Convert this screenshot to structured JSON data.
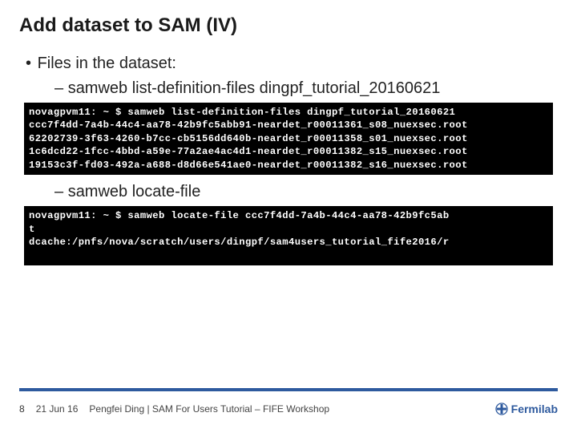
{
  "title": "Add dataset to SAM (IV)",
  "bullets": {
    "l1": "Files in the dataset:",
    "cmd1": "samweb list-definition-files dingpf_tutorial_20160621",
    "cmd2": "samweb locate-file"
  },
  "term1": {
    "prompt": "novagpvm11: ~ $ ",
    "cmd": "samweb list-definition-files dingpf_tutorial_20160621",
    "line1": "ccc7f4dd-7a4b-44c4-aa78-42b9fc5abb91-neardet_r00011361_s08_nuexsec.root",
    "line2": "62202739-3f63-4260-b7cc-cb5156dd640b-neardet_r00011358_s01_nuexsec.root",
    "line3": "1c6dcd22-1fcc-4bbd-a59e-77a2ae4ac4d1-neardet_r00011382_s15_nuexsec.root",
    "line4": "19153c3f-fd03-492a-a688-d8d66e541ae0-neardet_r00011382_s16_nuexsec.root"
  },
  "term2": {
    "prompt": "novagpvm11: ~ $ ",
    "cmd": "samweb locate-file ccc7f4dd-7a4b-44c4-aa78-42b9fc5ab",
    "cont": "t",
    "out": "dcache:/pnfs/nova/scratch/users/dingpf/sam4users_tutorial_fife2016/r"
  },
  "footer": {
    "page": "8",
    "date": "21 Jun 16",
    "author_line": "Pengfei Ding | SAM For Users Tutorial – FIFE Workshop",
    "logo_text": "Fermilab"
  }
}
